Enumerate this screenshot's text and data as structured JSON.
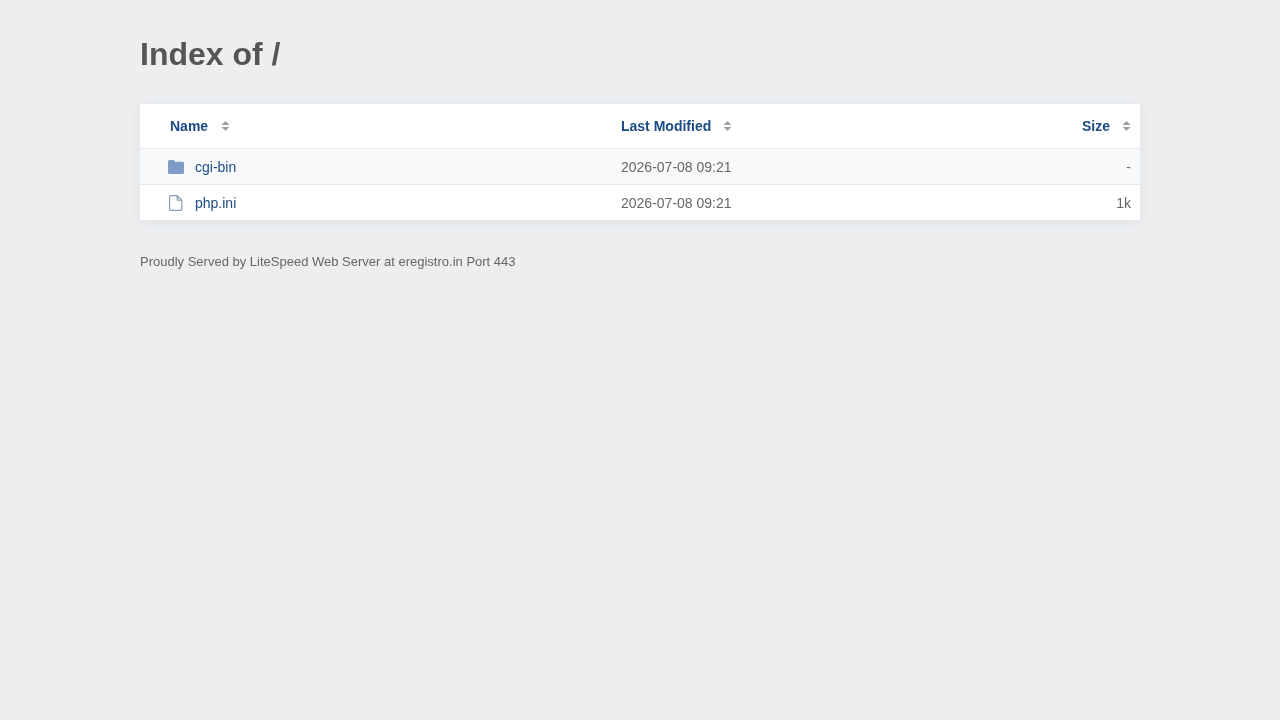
{
  "page": {
    "title": "Index of /"
  },
  "table": {
    "columns": [
      {
        "label": "Name"
      },
      {
        "label": "Last Modified"
      },
      {
        "label": "Size"
      }
    ],
    "rows": [
      {
        "kind": "folder",
        "name": "cgi-bin",
        "modified": "2026-07-08 09:21",
        "size": "-"
      },
      {
        "kind": "file",
        "name": "php.ini",
        "modified": "2026-07-08 09:21",
        "size": "1k"
      }
    ]
  },
  "footer": "Proudly Served by LiteSpeed Web Server at eregistro.in Port 443"
}
